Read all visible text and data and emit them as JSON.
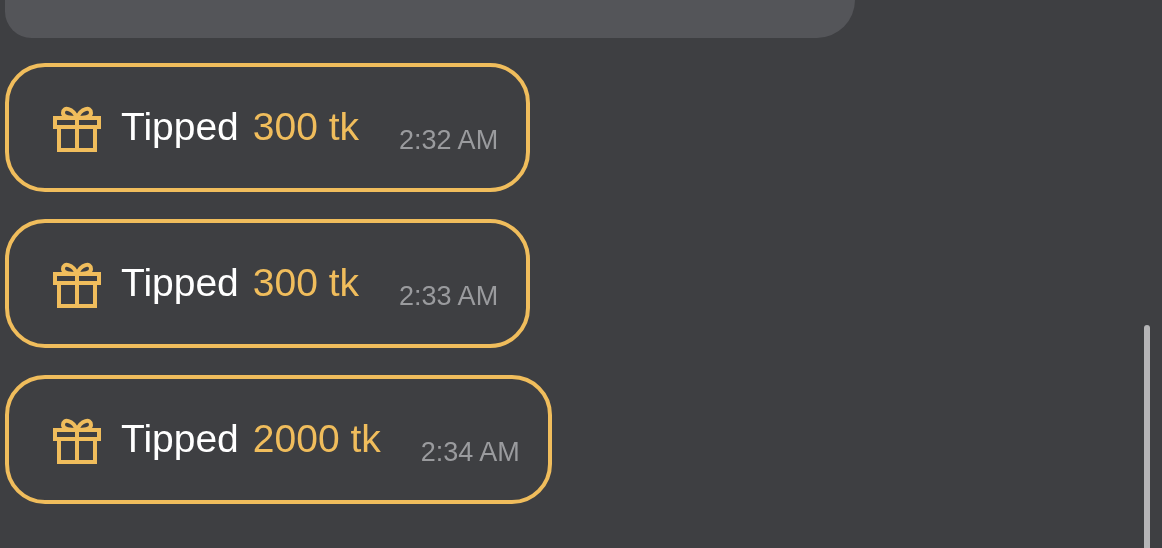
{
  "messages": [
    {
      "kind": "cut_bubble"
    },
    {
      "kind": "tip",
      "label": "Tipped",
      "amount": "300 tk",
      "time": "2:32 AM"
    },
    {
      "kind": "tip",
      "label": "Tipped",
      "amount": "300 tk",
      "time": "2:33 AM"
    },
    {
      "kind": "tip",
      "label": "Tipped",
      "amount": "2000 tk",
      "time": "2:34 AM"
    }
  ]
}
